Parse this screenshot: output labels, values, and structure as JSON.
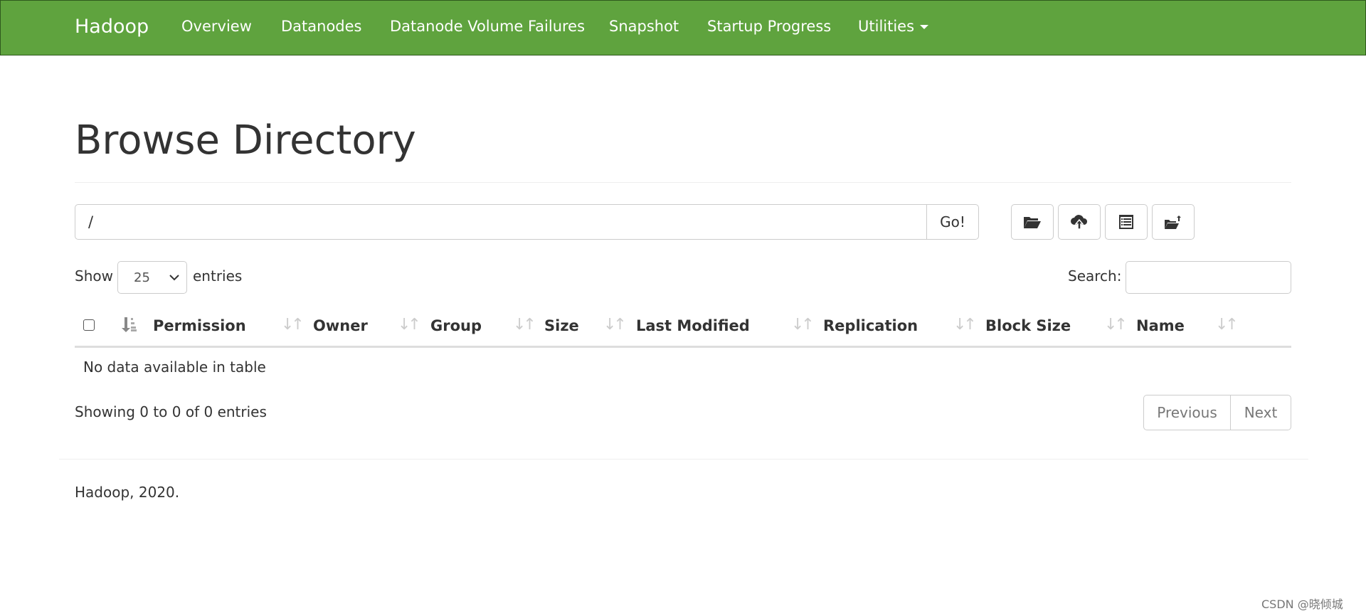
{
  "nav": {
    "brand": "Hadoop",
    "items": [
      "Overview",
      "Datanodes",
      "Datanode Volume Failures",
      "Snapshot",
      "Startup Progress",
      "Utilities"
    ],
    "color": "#5fa33e"
  },
  "page_title": "Browse Directory",
  "path_input": {
    "value": "/"
  },
  "go_label": "Go!",
  "toolbar_icons": [
    "folder-open-icon",
    "cloud-upload-icon",
    "list-alt-icon",
    "folder-upload-icon"
  ],
  "length": {
    "show": "Show",
    "value": "25",
    "entries": "entries"
  },
  "search": {
    "label": "Search:",
    "value": ""
  },
  "table": {
    "columns": [
      "Permission",
      "Owner",
      "Group",
      "Size",
      "Last Modified",
      "Replication",
      "Block Size",
      "Name"
    ],
    "empty": "No data available in table"
  },
  "info": "Showing 0 to 0 of 0 entries",
  "pagination": {
    "previous": "Previous",
    "next": "Next"
  },
  "footer": "Hadoop, 2020.",
  "watermark": "CSDN @晓倾城"
}
